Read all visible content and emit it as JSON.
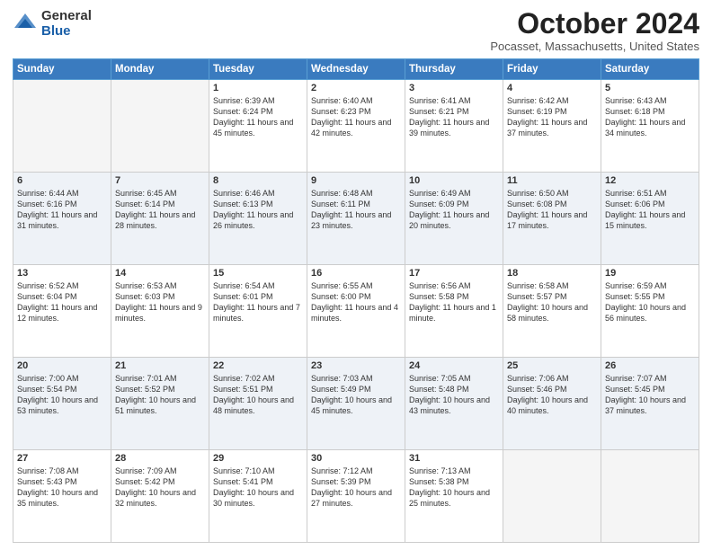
{
  "header": {
    "logo_line1": "General",
    "logo_line2": "Blue",
    "month_title": "October 2024",
    "location": "Pocasset, Massachusetts, United States"
  },
  "weekdays": [
    "Sunday",
    "Monday",
    "Tuesday",
    "Wednesday",
    "Thursday",
    "Friday",
    "Saturday"
  ],
  "weeks": [
    [
      {
        "day": "",
        "sunrise": "",
        "sunset": "",
        "daylight": ""
      },
      {
        "day": "",
        "sunrise": "",
        "sunset": "",
        "daylight": ""
      },
      {
        "day": "1",
        "sunrise": "Sunrise: 6:39 AM",
        "sunset": "Sunset: 6:24 PM",
        "daylight": "Daylight: 11 hours and 45 minutes."
      },
      {
        "day": "2",
        "sunrise": "Sunrise: 6:40 AM",
        "sunset": "Sunset: 6:23 PM",
        "daylight": "Daylight: 11 hours and 42 minutes."
      },
      {
        "day": "3",
        "sunrise": "Sunrise: 6:41 AM",
        "sunset": "Sunset: 6:21 PM",
        "daylight": "Daylight: 11 hours and 39 minutes."
      },
      {
        "day": "4",
        "sunrise": "Sunrise: 6:42 AM",
        "sunset": "Sunset: 6:19 PM",
        "daylight": "Daylight: 11 hours and 37 minutes."
      },
      {
        "day": "5",
        "sunrise": "Sunrise: 6:43 AM",
        "sunset": "Sunset: 6:18 PM",
        "daylight": "Daylight: 11 hours and 34 minutes."
      }
    ],
    [
      {
        "day": "6",
        "sunrise": "Sunrise: 6:44 AM",
        "sunset": "Sunset: 6:16 PM",
        "daylight": "Daylight: 11 hours and 31 minutes."
      },
      {
        "day": "7",
        "sunrise": "Sunrise: 6:45 AM",
        "sunset": "Sunset: 6:14 PM",
        "daylight": "Daylight: 11 hours and 28 minutes."
      },
      {
        "day": "8",
        "sunrise": "Sunrise: 6:46 AM",
        "sunset": "Sunset: 6:13 PM",
        "daylight": "Daylight: 11 hours and 26 minutes."
      },
      {
        "day": "9",
        "sunrise": "Sunrise: 6:48 AM",
        "sunset": "Sunset: 6:11 PM",
        "daylight": "Daylight: 11 hours and 23 minutes."
      },
      {
        "day": "10",
        "sunrise": "Sunrise: 6:49 AM",
        "sunset": "Sunset: 6:09 PM",
        "daylight": "Daylight: 11 hours and 20 minutes."
      },
      {
        "day": "11",
        "sunrise": "Sunrise: 6:50 AM",
        "sunset": "Sunset: 6:08 PM",
        "daylight": "Daylight: 11 hours and 17 minutes."
      },
      {
        "day": "12",
        "sunrise": "Sunrise: 6:51 AM",
        "sunset": "Sunset: 6:06 PM",
        "daylight": "Daylight: 11 hours and 15 minutes."
      }
    ],
    [
      {
        "day": "13",
        "sunrise": "Sunrise: 6:52 AM",
        "sunset": "Sunset: 6:04 PM",
        "daylight": "Daylight: 11 hours and 12 minutes."
      },
      {
        "day": "14",
        "sunrise": "Sunrise: 6:53 AM",
        "sunset": "Sunset: 6:03 PM",
        "daylight": "Daylight: 11 hours and 9 minutes."
      },
      {
        "day": "15",
        "sunrise": "Sunrise: 6:54 AM",
        "sunset": "Sunset: 6:01 PM",
        "daylight": "Daylight: 11 hours and 7 minutes."
      },
      {
        "day": "16",
        "sunrise": "Sunrise: 6:55 AM",
        "sunset": "Sunset: 6:00 PM",
        "daylight": "Daylight: 11 hours and 4 minutes."
      },
      {
        "day": "17",
        "sunrise": "Sunrise: 6:56 AM",
        "sunset": "Sunset: 5:58 PM",
        "daylight": "Daylight: 11 hours and 1 minute."
      },
      {
        "day": "18",
        "sunrise": "Sunrise: 6:58 AM",
        "sunset": "Sunset: 5:57 PM",
        "daylight": "Daylight: 10 hours and 58 minutes."
      },
      {
        "day": "19",
        "sunrise": "Sunrise: 6:59 AM",
        "sunset": "Sunset: 5:55 PM",
        "daylight": "Daylight: 10 hours and 56 minutes."
      }
    ],
    [
      {
        "day": "20",
        "sunrise": "Sunrise: 7:00 AM",
        "sunset": "Sunset: 5:54 PM",
        "daylight": "Daylight: 10 hours and 53 minutes."
      },
      {
        "day": "21",
        "sunrise": "Sunrise: 7:01 AM",
        "sunset": "Sunset: 5:52 PM",
        "daylight": "Daylight: 10 hours and 51 minutes."
      },
      {
        "day": "22",
        "sunrise": "Sunrise: 7:02 AM",
        "sunset": "Sunset: 5:51 PM",
        "daylight": "Daylight: 10 hours and 48 minutes."
      },
      {
        "day": "23",
        "sunrise": "Sunrise: 7:03 AM",
        "sunset": "Sunset: 5:49 PM",
        "daylight": "Daylight: 10 hours and 45 minutes."
      },
      {
        "day": "24",
        "sunrise": "Sunrise: 7:05 AM",
        "sunset": "Sunset: 5:48 PM",
        "daylight": "Daylight: 10 hours and 43 minutes."
      },
      {
        "day": "25",
        "sunrise": "Sunrise: 7:06 AM",
        "sunset": "Sunset: 5:46 PM",
        "daylight": "Daylight: 10 hours and 40 minutes."
      },
      {
        "day": "26",
        "sunrise": "Sunrise: 7:07 AM",
        "sunset": "Sunset: 5:45 PM",
        "daylight": "Daylight: 10 hours and 37 minutes."
      }
    ],
    [
      {
        "day": "27",
        "sunrise": "Sunrise: 7:08 AM",
        "sunset": "Sunset: 5:43 PM",
        "daylight": "Daylight: 10 hours and 35 minutes."
      },
      {
        "day": "28",
        "sunrise": "Sunrise: 7:09 AM",
        "sunset": "Sunset: 5:42 PM",
        "daylight": "Daylight: 10 hours and 32 minutes."
      },
      {
        "day": "29",
        "sunrise": "Sunrise: 7:10 AM",
        "sunset": "Sunset: 5:41 PM",
        "daylight": "Daylight: 10 hours and 30 minutes."
      },
      {
        "day": "30",
        "sunrise": "Sunrise: 7:12 AM",
        "sunset": "Sunset: 5:39 PM",
        "daylight": "Daylight: 10 hours and 27 minutes."
      },
      {
        "day": "31",
        "sunrise": "Sunrise: 7:13 AM",
        "sunset": "Sunset: 5:38 PM",
        "daylight": "Daylight: 10 hours and 25 minutes."
      },
      {
        "day": "",
        "sunrise": "",
        "sunset": "",
        "daylight": ""
      },
      {
        "day": "",
        "sunrise": "",
        "sunset": "",
        "daylight": ""
      }
    ]
  ]
}
